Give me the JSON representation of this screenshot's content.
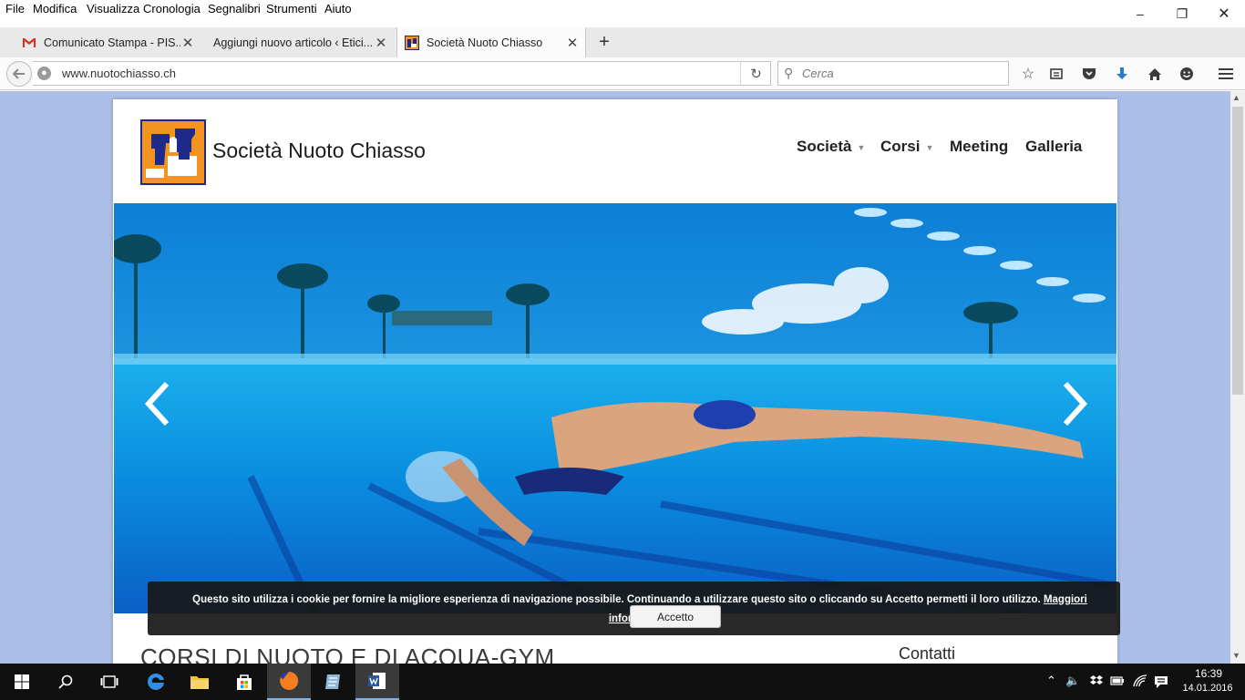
{
  "menubar": {
    "items": [
      "File",
      "Modifica",
      "Visualizza",
      "Cronologia",
      "Segnalibri",
      "Strumenti",
      "Aiuto"
    ]
  },
  "tabs": [
    {
      "title": "Comunicato Stampa - PIS...",
      "favicon": "gmail-icon"
    },
    {
      "title": "Aggiungi nuovo articolo ‹ Etici...",
      "favicon": "wordpress-icon"
    },
    {
      "title": "Società Nuoto Chiasso",
      "favicon": "snc-logo-icon",
      "active": true
    }
  ],
  "navbar": {
    "url": "www.nuotochiasso.ch",
    "search_placeholder": "Cerca"
  },
  "site": {
    "name": "Società Nuoto Chiasso",
    "nav": [
      {
        "label": "Società",
        "dropdown": true
      },
      {
        "label": "Corsi",
        "dropdown": true
      },
      {
        "label": "Meeting",
        "dropdown": false
      },
      {
        "label": "Galleria",
        "dropdown": false
      }
    ],
    "content_title": "CORSI DI NUOTO E DI ACQUA-GYM",
    "sidebar_title": "Contatti"
  },
  "cookie": {
    "text": "Questo sito utilizza i cookie per fornire la migliore esperienza di navigazione possibile. Continuando a utilizzare questo sito o cliccando su Accetto permetti il loro utilizzo.",
    "link_label": "Maggiori informazioni",
    "button_label": "Accetto"
  },
  "taskbar": {
    "time": "16:39",
    "date": "14.01.2016"
  },
  "colors": {
    "page_background": "#acbfe8",
    "logo_orange": "#f39322",
    "logo_blue": "#1d2a8a",
    "water_blue": "#0a8fe0"
  }
}
